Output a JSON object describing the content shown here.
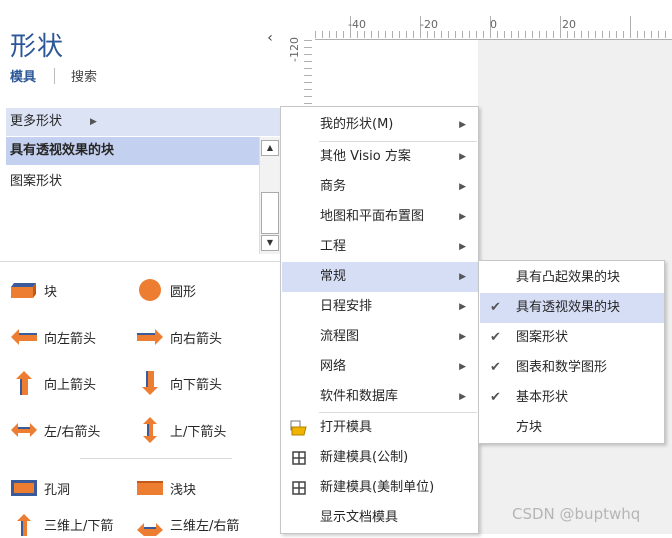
{
  "pane": {
    "title": "形状",
    "collapse_glyph": "‹",
    "tabs": [
      "模具",
      "搜索"
    ]
  },
  "stencils": {
    "more": "更多形状",
    "selected": "具有透视效果的块",
    "pattern": "图案形状"
  },
  "shapes": [
    {
      "label": "块",
      "icon": "block-icon"
    },
    {
      "label": "圆形",
      "icon": "circle-icon"
    },
    {
      "label": "向左箭头",
      "icon": "left-arrow-icon"
    },
    {
      "label": "向右箭头",
      "icon": "right-arrow-icon"
    },
    {
      "label": "向上箭头",
      "icon": "up-arrow-icon"
    },
    {
      "label": "向下箭头",
      "icon": "down-arrow-icon"
    },
    {
      "label": "左/右箭头",
      "icon": "left-right-arrow-icon"
    },
    {
      "label": "上/下箭头",
      "icon": "up-down-arrow-icon"
    },
    {
      "label": "孔洞",
      "icon": "hole-icon"
    },
    {
      "label": "浅块",
      "icon": "shallow-block-icon"
    },
    {
      "label": "三维上/下箭",
      "icon": "3d-up-down-arrow-icon"
    },
    {
      "label": "三维左/右箭",
      "icon": "3d-left-right-arrow-icon"
    }
  ],
  "ruler": {
    "h_labels": [
      "-40",
      "-20",
      "0",
      "20"
    ],
    "v_label": "-120"
  },
  "main_menu": {
    "items": [
      {
        "label": "我的形状(M)",
        "submenu": true
      },
      {
        "label": "其他 Visio 方案",
        "submenu": true
      },
      {
        "label": "商务",
        "submenu": true
      },
      {
        "label": "地图和平面布置图",
        "submenu": true
      },
      {
        "label": "工程",
        "submenu": true
      },
      {
        "label": "常规",
        "submenu": true
      },
      {
        "label": "日程安排",
        "submenu": true
      },
      {
        "label": "流程图",
        "submenu": true
      },
      {
        "label": "网络",
        "submenu": true
      },
      {
        "label": "软件和数据库",
        "submenu": true
      },
      {
        "label": "打开模具",
        "icon": "open-folder-icon"
      },
      {
        "label": "新建模具(公制)",
        "icon": "grid-icon"
      },
      {
        "label": "新建模具(美制单位)",
        "icon": "grid-icon"
      },
      {
        "label": "显示文档模具"
      }
    ],
    "highlighted_index": 5
  },
  "sub_menu": {
    "items": [
      {
        "label": "具有凸起效果的块",
        "checked": false
      },
      {
        "label": "具有透视效果的块",
        "checked": true
      },
      {
        "label": "图案形状",
        "checked": true
      },
      {
        "label": "图表和数学图形",
        "checked": true
      },
      {
        "label": "基本形状",
        "checked": true
      },
      {
        "label": "方块",
        "checked": false
      }
    ],
    "highlighted_index": 1
  },
  "watermark": "CSDN @buptwhq",
  "colors": {
    "accent": "#2b5797",
    "shape_fill": "#ed7d31",
    "highlight": "#d6def5",
    "selected_row": "#c3d0ef"
  }
}
